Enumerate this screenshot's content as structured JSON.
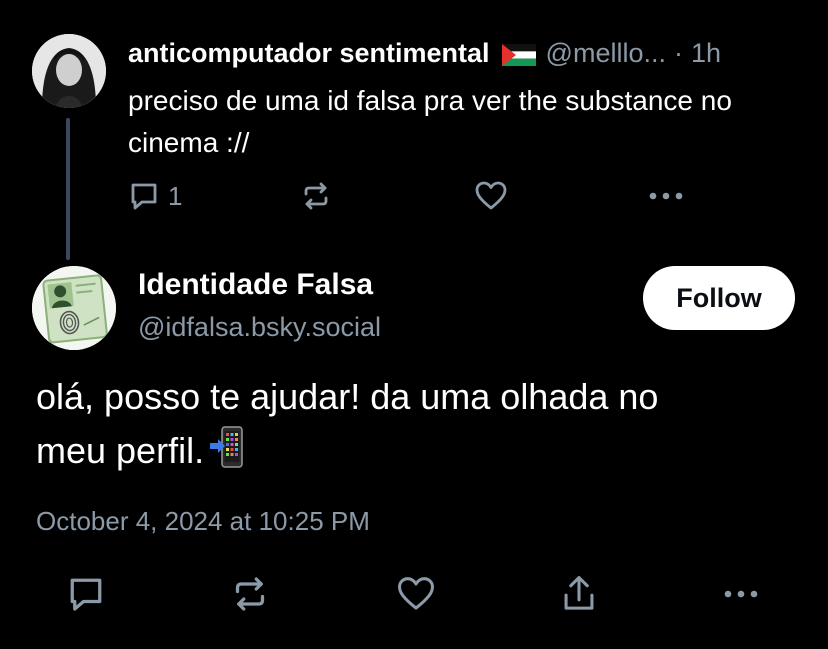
{
  "parent_post": {
    "author_name": "anticomputador sentimental",
    "flag_icon": "palestine-flag",
    "handle": "@melllo...",
    "separator": "·",
    "time": "1h",
    "text": "preciso de uma id falsa pra ver the substance no cinema ://",
    "reply_count": "1"
  },
  "main_post": {
    "author_name": "Identidade Falsa",
    "handle": "@idfalsa.bsky.social",
    "follow_label": "Follow",
    "text_line1": "olá, posso te ajudar! da uma olhada no",
    "text_line2": "meu perfil.",
    "emoji_icon": "mobile-phone-arrow-icon",
    "timestamp": "October 4, 2024 at 10:25 PM"
  },
  "colors": {
    "background": "#000000",
    "text": "#ffffff",
    "muted": "#8c9aa8",
    "thread_line": "#3a4a5c",
    "button_bg": "#ffffff"
  }
}
